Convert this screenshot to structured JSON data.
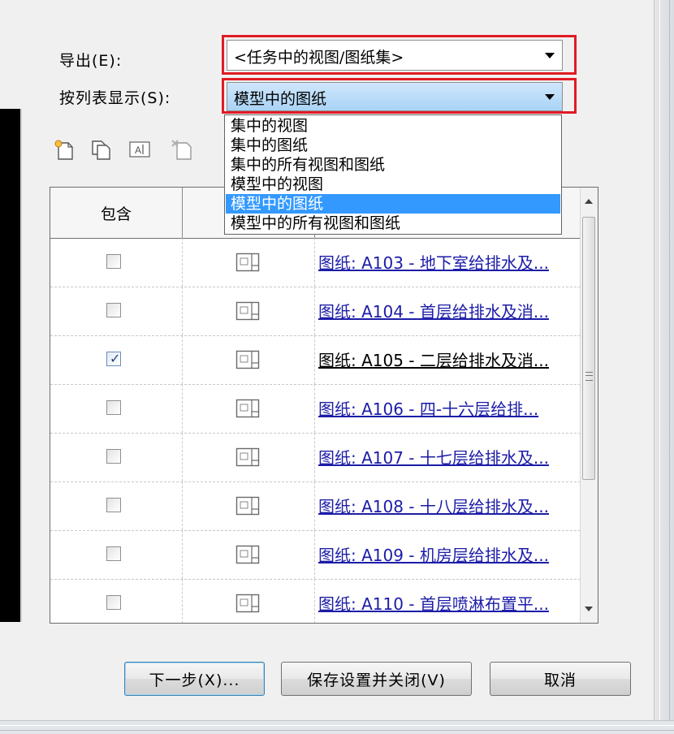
{
  "export_label": "导出(E):",
  "export_value": "<任务中的视图/图纸集>",
  "show_label": "按列表显示(S):",
  "show_value": "模型中的图纸",
  "dropdown_options": [
    {
      "label": "集中的视图",
      "selected": false
    },
    {
      "label": "集中的图纸",
      "selected": false
    },
    {
      "label": "集中的所有视图和图纸",
      "selected": false
    },
    {
      "label": "模型中的视图",
      "selected": false
    },
    {
      "label": "模型中的图纸",
      "selected": true
    },
    {
      "label": "模型中的所有视图和图纸",
      "selected": false
    }
  ],
  "toolbar_icons": [
    "new-set-icon",
    "duplicate-icon",
    "rename-icon",
    "delete-icon"
  ],
  "grid": {
    "col_include": "包含",
    "rows": [
      {
        "checked": false,
        "name": "图纸: A103 - 地下室给排水及..."
      },
      {
        "checked": false,
        "name": "图纸: A104 - 首层给排水及消..."
      },
      {
        "checked": true,
        "name": "图纸: A105 - 二层给排水及消..."
      },
      {
        "checked": false,
        "name": "图纸: A106 - 四-十六层给排..."
      },
      {
        "checked": false,
        "name": "图纸: A107 - 十七层给排水及..."
      },
      {
        "checked": false,
        "name": "图纸: A108 - 十八层给排水及..."
      },
      {
        "checked": false,
        "name": "图纸: A109 - 机房层给排水及..."
      },
      {
        "checked": false,
        "name": "图纸: A110 - 首层喷淋布置平..."
      }
    ]
  },
  "buttons": {
    "next": "下一步(X)...",
    "save_close": "保存设置并关闭(V)",
    "cancel": "取消"
  },
  "colors": {
    "highlight": "#3399ff",
    "red_outline": "#e01b24",
    "link": "#1c1ca8"
  }
}
